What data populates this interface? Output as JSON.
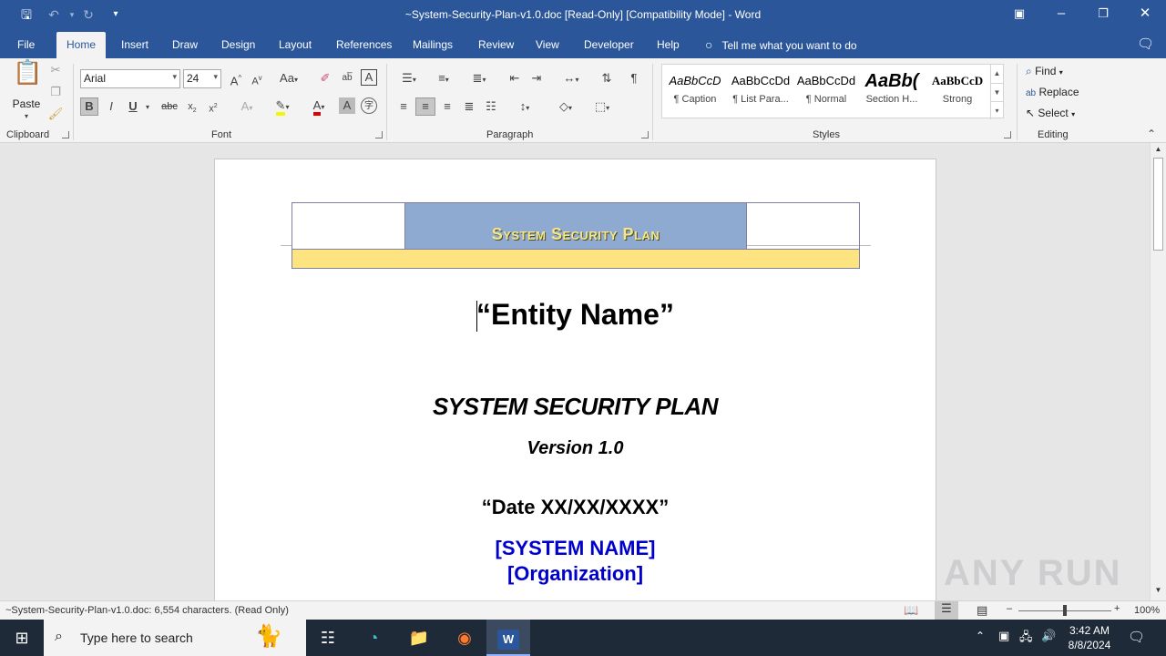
{
  "window": {
    "title": "~System-Security-Plan-v1.0.doc [Read-Only] [Compatibility Mode]  -  Word"
  },
  "tabs": [
    {
      "label": "File"
    },
    {
      "label": "Home"
    },
    {
      "label": "Insert"
    },
    {
      "label": "Draw"
    },
    {
      "label": "Design"
    },
    {
      "label": "Layout"
    },
    {
      "label": "References"
    },
    {
      "label": "Mailings"
    },
    {
      "label": "Review"
    },
    {
      "label": "View"
    },
    {
      "label": "Developer"
    },
    {
      "label": "Help"
    }
  ],
  "tell_me": "Tell me what you want to do",
  "ribbon": {
    "clipboard": {
      "paste_label": "Paste",
      "group_label": "Clipboard"
    },
    "font": {
      "name": "Arial",
      "size": "24",
      "group_label": "Font"
    },
    "paragraph": {
      "group_label": "Paragraph"
    },
    "styles": {
      "group_label": "Styles",
      "items": [
        {
          "preview": "AaBbCcD",
          "name": "¶ Caption"
        },
        {
          "preview": "AaBbCcDd",
          "name": "¶ List Para..."
        },
        {
          "preview": "AaBbCcDd",
          "name": "¶ Normal"
        },
        {
          "preview": "AaBb(",
          "name": "Section H..."
        },
        {
          "preview": "AaBbCcD",
          "name": "Strong"
        }
      ]
    },
    "editing": {
      "group_label": "Editing",
      "find": "Find",
      "replace": "Replace",
      "select": "Select"
    }
  },
  "document": {
    "header_title": "System Security Plan",
    "entity": "“Entity Name”",
    "heading": "SYSTEM SECURITY PLAN",
    "version": "Version 1.0",
    "date": "“Date XX/XX/XXXX”",
    "system_name": "[SYSTEM NAME]",
    "organization": "[Organization]",
    "heading_color": "#0000cc"
  },
  "status": {
    "left": "~System-Security-Plan-v1.0.doc: 6,554 characters.  (Read Only)",
    "zoom": "100%"
  },
  "watermark": "ANY RUN",
  "taskbar": {
    "search_placeholder": "Type here to search",
    "time": "3:42 AM",
    "date": "8/8/2024"
  }
}
